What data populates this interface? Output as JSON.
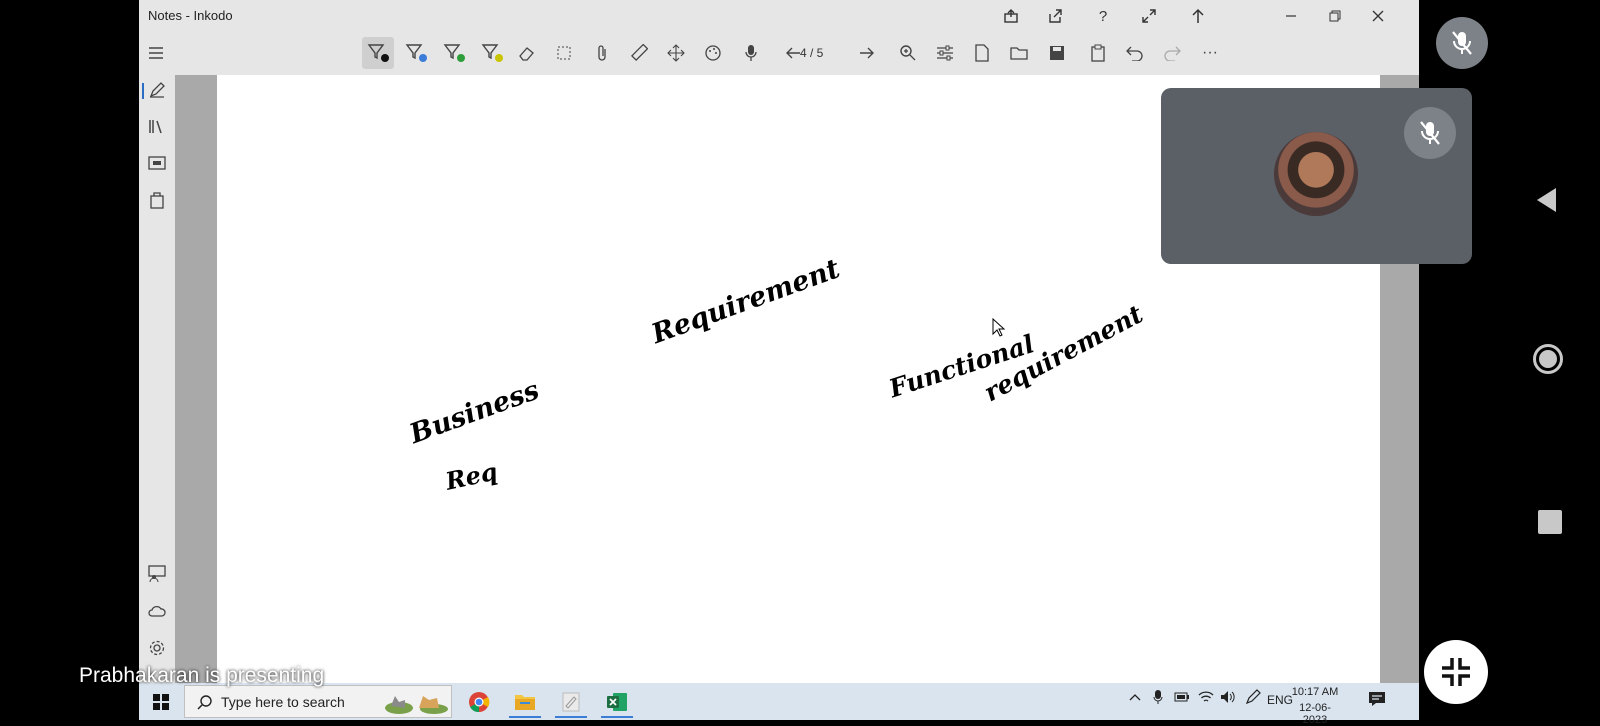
{
  "window": {
    "title": "Notes - Inkodo"
  },
  "toolbar": {
    "page_indicator": "4 / 5"
  },
  "canvas": {
    "ink_words": {
      "requirement_top": "Requirement",
      "functional": "Functional",
      "functional_req": "requirement",
      "business": "Business",
      "business_req": "Req"
    }
  },
  "taskbar": {
    "search_placeholder": "Type here to search",
    "language": "ENG",
    "time": "10:17 AM",
    "date": "12-06-2023"
  },
  "overlay": {
    "presenting_text": "Prabhakaran is presenting"
  },
  "colors": {
    "pen_black": "#111111",
    "pen_blue": "#3b7dd8",
    "pen_green": "#2e9e3a",
    "pen_yellow": "#c9c400",
    "excel": "#1d6f42"
  }
}
